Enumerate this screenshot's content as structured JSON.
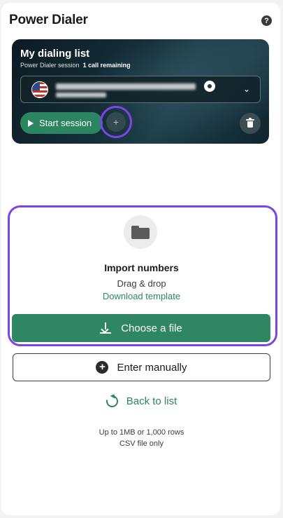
{
  "header": {
    "title": "Power Dialer",
    "help_glyph": "?"
  },
  "dialing_list": {
    "title": "My dialing list",
    "session_label": "Power Dialer session",
    "calls_remaining": "1 call remaining",
    "number_flag": "us-flag-icon",
    "start_label": "Start session",
    "add_glyph": "+"
  },
  "import": {
    "title": "Import numbers",
    "drag_drop": "Drag & drop",
    "template_link": "Download template",
    "choose_file": "Choose a file"
  },
  "manual": {
    "label": "Enter manually",
    "plus_glyph": "+"
  },
  "back": {
    "label": "Back to list"
  },
  "limits": {
    "line1": "Up to 1MB or 1,000 rows",
    "line2": "CSV file only"
  },
  "colors": {
    "accent_green": "#2e8662",
    "highlight_purple": "#7b44e6",
    "card_dark": "#15303b"
  }
}
